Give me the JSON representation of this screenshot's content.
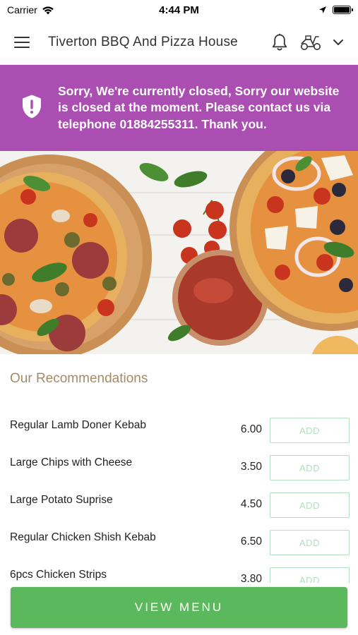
{
  "status_bar": {
    "carrier": "Carrier",
    "time": "4:44 PM"
  },
  "header": {
    "title": "Tiverton BBQ And Pizza House",
    "icons": [
      "menu-icon",
      "bell-icon",
      "scooter-icon",
      "chevron-down-icon"
    ]
  },
  "banner": {
    "message": "Sorry, We're currently closed, Sorry our website is closed at the moment. Please contact us via telephone 01884255311. Thank you.",
    "icon": "shield-alert-icon",
    "background": "#aa4eb2"
  },
  "recommendations": {
    "title": "Our Recommendations",
    "items": [
      {
        "name": "Regular Lamb Doner Kebab",
        "price": "6.00",
        "button": "ADD"
      },
      {
        "name": "Large Chips with Cheese",
        "price": "3.50",
        "button": "ADD"
      },
      {
        "name": "Large Potato Suprise",
        "price": "4.50",
        "button": "ADD"
      },
      {
        "name": "Regular Chicken Shish Kebab",
        "price": "6.50",
        "button": "ADD"
      },
      {
        "name": "6pcs Chicken Strips",
        "price": "3.80",
        "button": "ADD"
      }
    ]
  },
  "view_menu": {
    "label": "VIEW MENU",
    "color": "#5cb85c"
  },
  "colors": {
    "accent_gold": "#a48b68",
    "add_border": "#b2dfbf"
  }
}
